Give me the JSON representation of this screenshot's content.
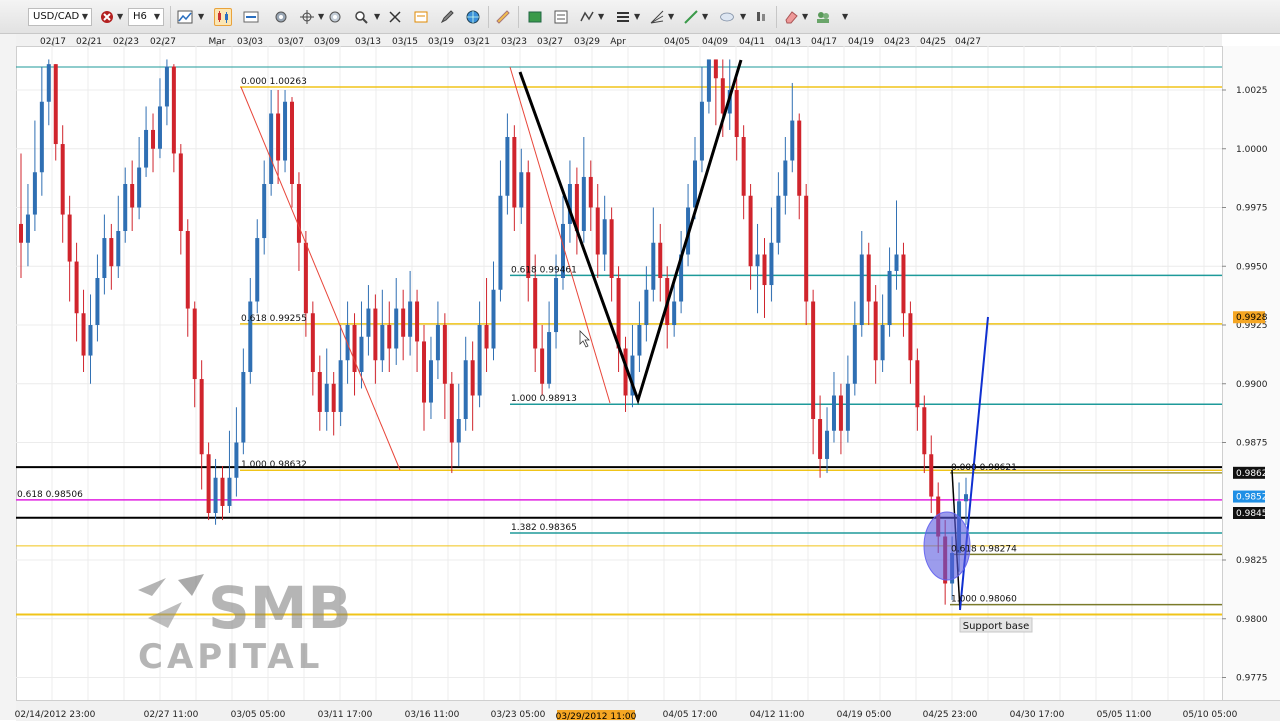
{
  "toolbar": {
    "symbol": "USD/CAD",
    "timeframe": "H6",
    "icons": [
      "red-x-dropdown-icon",
      "area-chart-icon",
      "candlestick-chart-icon",
      "ruler-icon",
      "settings-icon",
      "crosshair-icon",
      "zoom-icon",
      "cursor-icon",
      "text-icon",
      "pencil-icon",
      "globe-icon",
      "ruler-icon",
      "trade-icon",
      "object-list-icon",
      "indicator-icon",
      "horizontal-lines-icon",
      "fibonacci-fan-icon",
      "line-tool-icon",
      "ellipse-tool-icon",
      "candle-settings-icon",
      "eraser-icon",
      "account-icon"
    ]
  },
  "top_axis_labels": [
    {
      "x": 53,
      "t": "02/17"
    },
    {
      "x": 89,
      "t": "02/21"
    },
    {
      "x": 126,
      "t": "02/23"
    },
    {
      "x": 163,
      "t": "02/27"
    },
    {
      "x": 217,
      "t": "Mar"
    },
    {
      "x": 250,
      "t": "03/03"
    },
    {
      "x": 291,
      "t": "03/07"
    },
    {
      "x": 327,
      "t": "03/09"
    },
    {
      "x": 368,
      "t": "03/13"
    },
    {
      "x": 405,
      "t": "03/15"
    },
    {
      "x": 441,
      "t": "03/19"
    },
    {
      "x": 477,
      "t": "03/21"
    },
    {
      "x": 514,
      "t": "03/23"
    },
    {
      "x": 550,
      "t": "03/27"
    },
    {
      "x": 587,
      "t": "03/29"
    },
    {
      "x": 618,
      "t": "Apr"
    },
    {
      "x": 677,
      "t": "04/05"
    },
    {
      "x": 715,
      "t": "04/09"
    },
    {
      "x": 752,
      "t": "04/11"
    },
    {
      "x": 788,
      "t": "04/13"
    },
    {
      "x": 824,
      "t": "04/17"
    },
    {
      "x": 861,
      "t": "04/19"
    },
    {
      "x": 897,
      "t": "04/23"
    },
    {
      "x": 933,
      "t": "04/25"
    },
    {
      "x": 968,
      "t": "04/27"
    }
  ],
  "bottom_axis_labels": [
    {
      "x": 55,
      "t": "02/14/2012 23:00"
    },
    {
      "x": 171,
      "t": "02/27 11:00"
    },
    {
      "x": 258,
      "t": "03/05 05:00"
    },
    {
      "x": 345,
      "t": "03/11 17:00"
    },
    {
      "x": 432,
      "t": "03/16 11:00"
    },
    {
      "x": 518,
      "t": "03/23 05:00"
    },
    {
      "x": 690,
      "t": "04/05 17:00"
    },
    {
      "x": 777,
      "t": "04/12 11:00"
    },
    {
      "x": 864,
      "t": "04/19 05:00"
    },
    {
      "x": 950,
      "t": "04/25 23:00"
    },
    {
      "x": 1037,
      "t": "04/30 17:00"
    },
    {
      "x": 1124,
      "t": "05/05 11:00"
    },
    {
      "x": 1210,
      "t": "05/10 05:00"
    }
  ],
  "bottom_axis_highlight": {
    "x": 596,
    "t": "03/29/2012 11:00",
    "color": "#f5a623"
  },
  "price_axis": {
    "ticks": [
      {
        "p": 1.0025,
        "t": "1.0025"
      },
      {
        "p": 1.0,
        "t": "1.0000"
      },
      {
        "p": 0.9975,
        "t": "0.9975"
      },
      {
        "p": 0.995,
        "t": "0.9950"
      },
      {
        "p": 0.9925,
        "t": "0.9925"
      },
      {
        "p": 0.99,
        "t": "0.9900"
      },
      {
        "p": 0.9875,
        "t": "0.9875"
      },
      {
        "p": 0.9825,
        "t": "0.9825"
      },
      {
        "p": 0.98,
        "t": "0.9800"
      },
      {
        "p": 0.9775,
        "t": "0.9775"
      }
    ],
    "badges": [
      {
        "p": 0.99283,
        "t": "0.9928",
        "color": "#f5a623",
        "text_color": "#000000"
      },
      {
        "p": 0.98621,
        "t": "0.9862",
        "color": "#111111",
        "text_color": "#ffffff"
      },
      {
        "p": 0.9852,
        "t": "0.9852",
        "color": "#1f8fe5",
        "text_color": "#ffffff"
      },
      {
        "p": 0.9845,
        "t": "0.9845",
        "color": "#111111",
        "text_color": "#ffffff"
      }
    ]
  },
  "chart_data": {
    "type": "candlestick",
    "symbol": "USD/CAD",
    "timeframe": "H6",
    "ylim": [
      0.9765,
      1.004
    ],
    "up_color": "#2f6fb3",
    "down_color": "#d0242c",
    "candles": [
      [
        0.9968,
        0.996,
        0.9998,
        0.9945
      ],
      [
        0.996,
        0.9972,
        0.9985,
        0.995
      ],
      [
        0.9972,
        0.999,
        1.0012,
        0.9965
      ],
      [
        0.999,
        1.002,
        1.0035,
        0.998
      ],
      [
        1.002,
        1.0036,
        1.0038,
        1.001
      ],
      [
        1.0036,
        1.0002,
        1.0036,
        0.9995
      ],
      [
        1.0002,
        0.9972,
        1.001,
        0.996
      ],
      [
        0.9972,
        0.9952,
        0.998,
        0.9935
      ],
      [
        0.9952,
        0.993,
        0.996,
        0.9918
      ],
      [
        0.993,
        0.9912,
        0.994,
        0.9905
      ],
      [
        0.9912,
        0.9925,
        0.9938,
        0.99
      ],
      [
        0.9925,
        0.9945,
        0.9955,
        0.9918
      ],
      [
        0.9945,
        0.9962,
        0.9972,
        0.9938
      ],
      [
        0.9962,
        0.995,
        0.9968,
        0.994
      ],
      [
        0.995,
        0.9965,
        0.998,
        0.9945
      ],
      [
        0.9965,
        0.9985,
        0.9992,
        0.996
      ],
      [
        0.9985,
        0.9975,
        0.9995,
        0.9965
      ],
      [
        0.9975,
        0.9992,
        1.0005,
        0.997
      ],
      [
        0.9992,
        1.0008,
        1.0018,
        0.9988
      ],
      [
        1.0008,
        1.0,
        1.0015,
        0.999
      ],
      [
        1.0,
        1.0018,
        1.003,
        0.9996
      ],
      [
        1.0018,
        1.0035,
        1.0038,
        1.001
      ],
      [
        1.0035,
        0.9998,
        1.0036,
        0.999
      ],
      [
        0.9998,
        0.9965,
        1.0002,
        0.9955
      ],
      [
        0.9965,
        0.9932,
        0.997,
        0.992
      ],
      [
        0.9932,
        0.9902,
        0.9935,
        0.989
      ],
      [
        0.9902,
        0.987,
        0.991,
        0.9855
      ],
      [
        0.987,
        0.9845,
        0.9875,
        0.9842
      ],
      [
        0.9845,
        0.986,
        0.9868,
        0.984
      ],
      [
        0.986,
        0.9848,
        0.9865,
        0.9842
      ],
      [
        0.9848,
        0.986,
        0.988,
        0.9845
      ],
      [
        0.986,
        0.9875,
        0.989,
        0.9852
      ],
      [
        0.9875,
        0.9905,
        0.9915,
        0.987
      ],
      [
        0.9905,
        0.9935,
        0.9945,
        0.99
      ],
      [
        0.9935,
        0.9962,
        0.997,
        0.993
      ],
      [
        0.9962,
        0.9985,
        0.9995,
        0.9955
      ],
      [
        0.9985,
        1.0015,
        1.0025,
        0.998
      ],
      [
        1.0015,
        0.9995,
        1.0025,
        0.9985
      ],
      [
        0.9995,
        1.002,
        1.0025,
        0.999
      ],
      [
        1.002,
        0.9985,
        1.0022,
        0.9975
      ],
      [
        0.9985,
        0.996,
        0.999,
        0.9948
      ],
      [
        0.996,
        0.993,
        0.9965,
        0.992
      ],
      [
        0.993,
        0.9905,
        0.9935,
        0.9895
      ],
      [
        0.9905,
        0.9888,
        0.9912,
        0.988
      ],
      [
        0.9888,
        0.99,
        0.9915,
        0.988
      ],
      [
        0.99,
        0.9888,
        0.9905,
        0.9878
      ],
      [
        0.9888,
        0.991,
        0.9925,
        0.9882
      ],
      [
        0.991,
        0.9925,
        0.9935,
        0.99
      ],
      [
        0.9925,
        0.9905,
        0.993,
        0.9895
      ],
      [
        0.9905,
        0.992,
        0.9935,
        0.9898
      ],
      [
        0.992,
        0.9932,
        0.9942,
        0.9912
      ],
      [
        0.9932,
        0.991,
        0.9938,
        0.99
      ],
      [
        0.991,
        0.9925,
        0.994,
        0.9905
      ],
      [
        0.9925,
        0.9915,
        0.9935,
        0.9905
      ],
      [
        0.9915,
        0.9932,
        0.9945,
        0.9908
      ],
      [
        0.9932,
        0.992,
        0.994,
        0.991
      ],
      [
        0.992,
        0.9935,
        0.9948,
        0.9912
      ],
      [
        0.9935,
        0.9918,
        0.994,
        0.9905
      ],
      [
        0.9918,
        0.9892,
        0.9925,
        0.988
      ],
      [
        0.9892,
        0.991,
        0.992,
        0.9885
      ],
      [
        0.991,
        0.9925,
        0.9935,
        0.9902
      ],
      [
        0.9925,
        0.99,
        0.993,
        0.9885
      ],
      [
        0.99,
        0.9875,
        0.9905,
        0.9862
      ],
      [
        0.9875,
        0.9885,
        0.99,
        0.9865
      ],
      [
        0.9885,
        0.991,
        0.992,
        0.988
      ],
      [
        0.991,
        0.9895,
        0.9918,
        0.988
      ],
      [
        0.9895,
        0.9925,
        0.9935,
        0.989
      ],
      [
        0.9925,
        0.9915,
        0.9945,
        0.9905
      ],
      [
        0.9915,
        0.994,
        0.9952,
        0.991
      ],
      [
        0.994,
        0.998,
        0.9995,
        0.9935
      ],
      [
        0.998,
        1.0005,
        1.0015,
        0.9972
      ],
      [
        1.0005,
        0.9975,
        1.001,
        0.9965
      ],
      [
        0.9975,
        0.999,
        1.0,
        0.9968
      ],
      [
        0.999,
        0.9945,
        0.9995,
        0.9935
      ],
      [
        0.9945,
        0.9915,
        0.9955,
        0.9905
      ],
      [
        0.9915,
        0.99,
        0.9925,
        0.9895
      ],
      [
        0.99,
        0.9922,
        0.9935,
        0.9898
      ],
      [
        0.9922,
        0.9945,
        0.9955,
        0.9915
      ],
      [
        0.9945,
        0.9968,
        0.998,
        0.994
      ],
      [
        0.9968,
        0.9985,
        0.9995,
        0.996
      ],
      [
        0.9985,
        0.9965,
        0.9992,
        0.9955
      ],
      [
        0.9965,
        0.9988,
        1.0005,
        0.996
      ],
      [
        0.9988,
        0.9975,
        0.9995,
        0.9965
      ],
      [
        0.9975,
        0.9955,
        0.9985,
        0.9945
      ],
      [
        0.9955,
        0.997,
        0.998,
        0.9948
      ],
      [
        0.997,
        0.9945,
        0.9975,
        0.9935
      ],
      [
        0.9945,
        0.9915,
        0.995,
        0.9905
      ],
      [
        0.9915,
        0.9895,
        0.992,
        0.9888
      ],
      [
        0.9895,
        0.9912,
        0.9925,
        0.989
      ],
      [
        0.9912,
        0.9925,
        0.9935,
        0.9905
      ],
      [
        0.9925,
        0.994,
        0.995,
        0.9918
      ],
      [
        0.994,
        0.996,
        0.9975,
        0.9935
      ],
      [
        0.996,
        0.9945,
        0.9968,
        0.9935
      ],
      [
        0.9945,
        0.9925,
        0.995,
        0.9915
      ],
      [
        0.9925,
        0.9935,
        0.9945,
        0.992
      ],
      [
        0.9935,
        0.9955,
        0.9965,
        0.993
      ],
      [
        0.9955,
        0.9975,
        0.9985,
        0.995
      ],
      [
        0.9975,
        0.9995,
        1.0005,
        0.997
      ],
      [
        0.9995,
        1.002,
        1.0035,
        0.999
      ],
      [
        1.002,
        1.0038,
        1.0038,
        1.0015
      ],
      [
        1.0038,
        1.003,
        1.0038,
        1.001
      ],
      [
        1.003,
        1.0015,
        1.0038,
        1.0005
      ],
      [
        1.0015,
        1.0025,
        1.0038,
        1.0008
      ],
      [
        1.0025,
        1.0005,
        1.003,
        0.9995
      ],
      [
        1.0005,
        0.998,
        1.001,
        0.997
      ],
      [
        0.998,
        0.995,
        0.9985,
        0.994
      ],
      [
        0.995,
        0.9955,
        0.9968,
        0.993
      ],
      [
        0.9955,
        0.9942,
        0.9962,
        0.9928
      ],
      [
        0.9942,
        0.996,
        0.9975,
        0.9935
      ],
      [
        0.996,
        0.998,
        0.999,
        0.9955
      ],
      [
        0.998,
        0.9995,
        1.0005,
        0.9972
      ],
      [
        0.9995,
        1.0012,
        1.0028,
        0.999
      ],
      [
        1.0012,
        0.998,
        1.0015,
        0.997
      ],
      [
        0.998,
        0.9935,
        0.9985,
        0.9925
      ],
      [
        0.9935,
        0.9885,
        0.994,
        0.987
      ],
      [
        0.9885,
        0.9868,
        0.9895,
        0.986
      ],
      [
        0.9868,
        0.988,
        0.989,
        0.9862
      ],
      [
        0.988,
        0.9895,
        0.9905,
        0.9875
      ],
      [
        0.9895,
        0.988,
        0.99,
        0.987
      ],
      [
        0.988,
        0.99,
        0.9912,
        0.9875
      ],
      [
        0.99,
        0.9925,
        0.9935,
        0.9895
      ],
      [
        0.9925,
        0.9955,
        0.9965,
        0.992
      ],
      [
        0.9955,
        0.9935,
        0.996,
        0.9925
      ],
      [
        0.9935,
        0.991,
        0.9942,
        0.99
      ],
      [
        0.991,
        0.9925,
        0.9938,
        0.9905
      ],
      [
        0.9925,
        0.9948,
        0.9958,
        0.992
      ],
      [
        0.9948,
        0.9955,
        0.9978,
        0.994
      ],
      [
        0.9955,
        0.993,
        0.996,
        0.992
      ],
      [
        0.993,
        0.991,
        0.9935,
        0.99
      ],
      [
        0.991,
        0.989,
        0.9915,
        0.988
      ],
      [
        0.989,
        0.987,
        0.9895,
        0.9862
      ],
      [
        0.987,
        0.9852,
        0.9878,
        0.9845
      ],
      [
        0.9852,
        0.9835,
        0.9858,
        0.9828
      ],
      [
        0.9835,
        0.9815,
        0.9842,
        0.9806
      ],
      [
        0.9815,
        0.9828,
        0.9835,
        0.9808
      ],
      [
        0.9828,
        0.985,
        0.9858,
        0.982
      ],
      [
        0.985,
        0.9853,
        0.986,
        0.984
      ]
    ],
    "fibonacci_levels": [
      {
        "label": "0.000 1.00263",
        "price": 1.00263,
        "color": "#f0c419",
        "x1": 240,
        "x2": 1222
      },
      {
        "label": "0.618 0.99255",
        "price": 0.99255,
        "color": "#f0c419",
        "x1": 240,
        "x2": 1222
      },
      {
        "label": "1.000 0.98632",
        "price": 0.98632,
        "color": "#f0c419",
        "x1": 240,
        "x2": 1222
      },
      {
        "label": "0.618 0.99461",
        "price": 0.99461,
        "color": "#1e9a9a",
        "x1": 510,
        "x2": 1222
      },
      {
        "label": "1.000 0.98913",
        "price": 0.98913,
        "color": "#1e9a9a",
        "x1": 510,
        "x2": 1222
      },
      {
        "label": "1.382 0.98365",
        "price": 0.98365,
        "color": "#1e9a9a",
        "x1": 510,
        "x2": 1222
      },
      {
        "label": "0.618 0.98506",
        "price": 0.98506,
        "color": "#e020e0",
        "x1": 16,
        "x2": 1222
      },
      {
        "label": "0.000 0.98621",
        "price": 0.98621,
        "color": "#a09a3a",
        "x1": 950,
        "x2": 1222
      },
      {
        "label": "0.618 0.98274",
        "price": 0.98274,
        "color": "#7a7a2a",
        "x1": 950,
        "x2": 1222
      },
      {
        "label": "1.000 0.98060",
        "price": 0.9806,
        "color": "#7a7a2a",
        "x1": 950,
        "x2": 1222
      }
    ],
    "horizontal_lines": [
      {
        "price": 0.98645,
        "color": "#000000",
        "width": 2
      },
      {
        "price": 0.9843,
        "color": "#000000",
        "width": 2
      },
      {
        "price": 0.9831,
        "color": "#f0c419",
        "width": 1
      },
      {
        "price": 0.98018,
        "color": "#f0c419",
        "width": 2
      },
      {
        "price": 1.00348,
        "color": "#1e9a9a",
        "width": 1
      }
    ],
    "annotations": [
      {
        "label": "Support base"
      }
    ]
  },
  "logo": {
    "line1": "SMB",
    "line2": "CAPITAL"
  }
}
